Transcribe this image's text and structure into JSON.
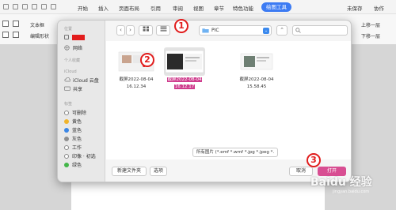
{
  "app": {
    "menu": [
      "开始",
      "插入",
      "页面布局",
      "引用",
      "审阅",
      "视图",
      "章节",
      "特色功能"
    ],
    "active_tab": "绘图工具",
    "ribbon_texts": [
      "文本框",
      "编辑形状",
      "上移一层",
      "下移一层",
      "未保存",
      "协作"
    ]
  },
  "dialog": {
    "path_label": "PIC",
    "sidebar": {
      "favorites_label": "位置",
      "network": "网络",
      "personal_label": "个人收藏",
      "icloud_label": "iCloud",
      "icloud_drive": "iCloud 云盘",
      "shared": "共享",
      "tags_label": "标签",
      "tags": [
        {
          "name": "可删除",
          "color": "#ffffff"
        },
        {
          "name": "黄色",
          "color": "#f0b42c"
        },
        {
          "name": "蓝色",
          "color": "#3a86e6"
        },
        {
          "name": "灰色",
          "color": "#8e8e8e"
        },
        {
          "name": "工作",
          "color": "#ffffff"
        },
        {
          "name": "印像 · 初选",
          "color": "#ffffff"
        },
        {
          "name": "绿色",
          "color": "#43b649"
        }
      ]
    },
    "files": [
      {
        "line1": "截屏2022-08-04",
        "line2": "16.12.34",
        "selected": false
      },
      {
        "line1": "截屏2022-08-04",
        "line2": "16.12.17",
        "selected": true
      },
      {
        "line1": "截屏2022-08-04",
        "line2": "15.58.45",
        "selected": false
      }
    ],
    "filter": "所有图片 (*.emf *.wmf *.jpg *.jpeg *.",
    "new_folder": "新建文件夹",
    "options": "选项",
    "cancel": "取消",
    "open": "打开"
  },
  "markers": [
    "1",
    "2",
    "3"
  ],
  "watermark": "Baidu 经验",
  "watermark_sub": "jingyan.baidu.com",
  "colors": {
    "accent": "#3c7bf3",
    "highlight": "#cf3c8d",
    "marker": "#e11d1d"
  }
}
